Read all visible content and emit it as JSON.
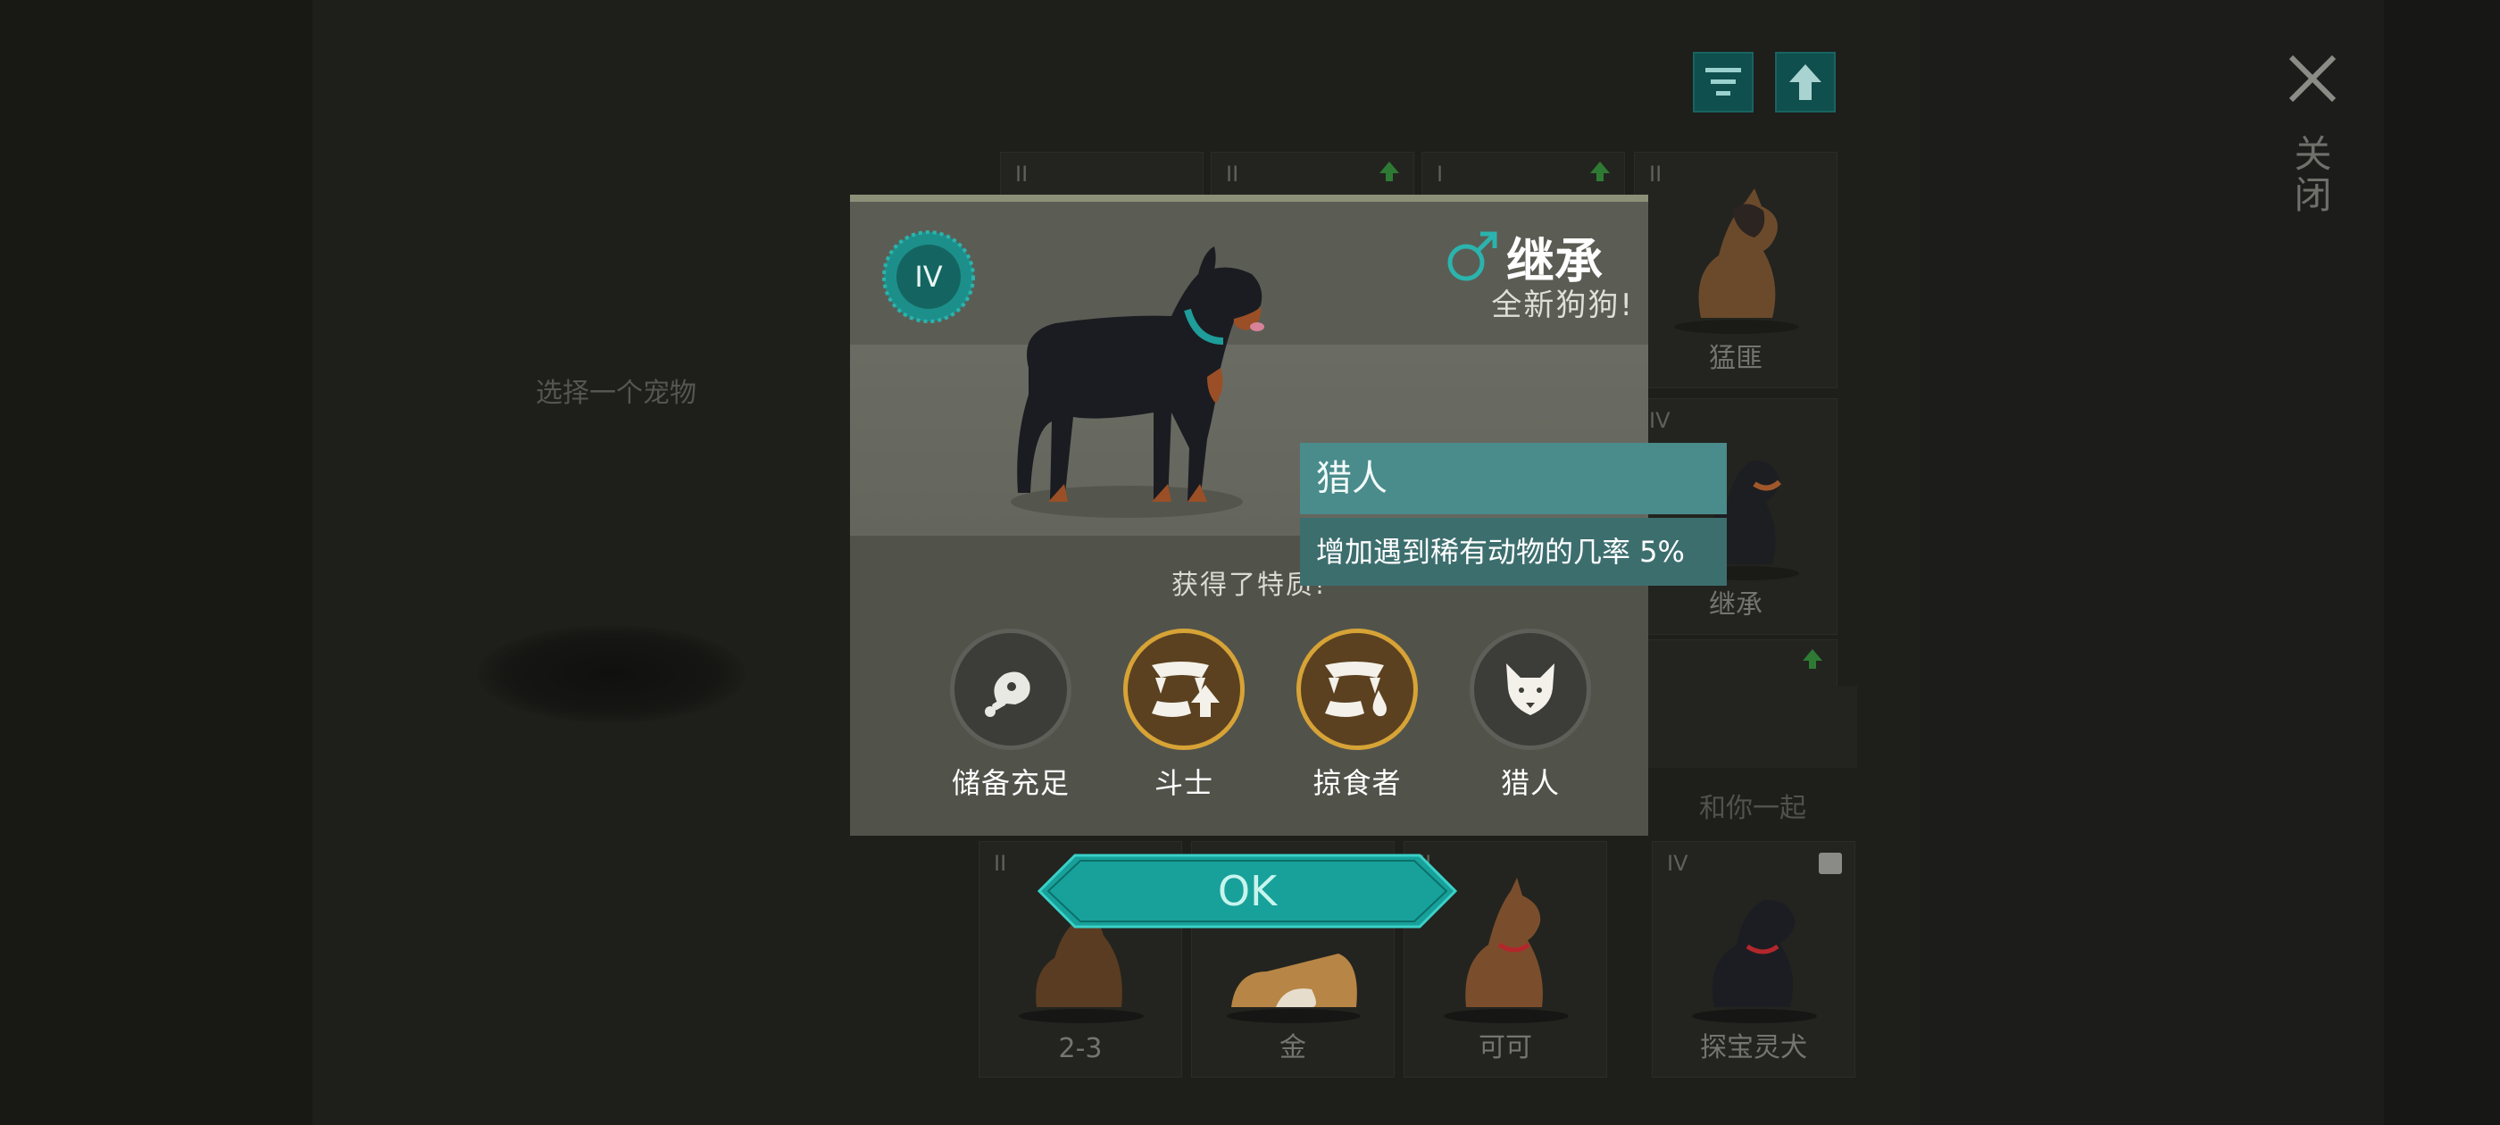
{
  "background": {
    "select_hint": "选择一个宠物",
    "close_label": "关闭",
    "together_label": "和你一起"
  },
  "grid": {
    "cards": [
      {
        "tier": "II",
        "name": "",
        "upgrade": false
      },
      {
        "tier": "II",
        "name": "",
        "upgrade": true
      },
      {
        "tier": "I",
        "name": "",
        "upgrade": true
      },
      {
        "tier": "II",
        "name": "猛匪",
        "upgrade": false
      },
      {
        "tier": "IV",
        "name": "继承",
        "upgrade": false
      },
      {
        "tier": "",
        "name": "",
        "upgrade": true
      },
      {
        "tier": "II",
        "name": "2-3",
        "upgrade": false
      },
      {
        "tier": "",
        "name": "金",
        "upgrade": false
      },
      {
        "tier": "II",
        "name": "可可",
        "upgrade": false
      },
      {
        "tier": "IV",
        "name": "探宝灵犬",
        "upgrade": false
      }
    ]
  },
  "modal": {
    "tier_badge": "IV",
    "gender_icon": "male-symbol-icon",
    "dog_name": "继承",
    "subtitle": "全新狗狗!",
    "traits_title": "获得了特质!",
    "traits": [
      {
        "label": "储备充足",
        "icon": "meat-icon",
        "style": "grey"
      },
      {
        "label": "斗士",
        "icon": "fangs-up-icon",
        "style": "gold"
      },
      {
        "label": "掠食者",
        "icon": "fangs-drop-icon",
        "style": "gold"
      },
      {
        "label": "猎人",
        "icon": "wolf-head-icon",
        "style": "grey"
      }
    ],
    "tooltip": {
      "title": "猎人",
      "description": "增加遇到稀有动物的几率 5%"
    },
    "ok_label": "OK"
  },
  "colors": {
    "accent_teal": "#2bb4ad",
    "gold_ring": "#d7a336",
    "upgrade_green": "#2e7a35"
  }
}
